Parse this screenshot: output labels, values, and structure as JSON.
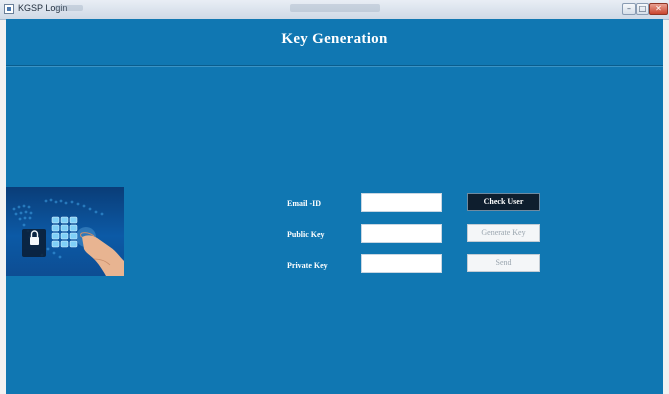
{
  "window": {
    "title": "KGSP Login",
    "minimize_label": "–",
    "maximize_label": "□",
    "close_label": "✕"
  },
  "header": {
    "title": "Key Generation"
  },
  "form": {
    "email_label": "Email -ID",
    "email_value": "",
    "public_key_label": "Public Key",
    "public_key_value": "",
    "private_key_label": "Private Key",
    "private_key_value": ""
  },
  "buttons": {
    "check_user": "Check User",
    "generate_key": "Generate Key",
    "send": "Send"
  },
  "colors": {
    "background": "#1077b2",
    "primary_button": "#0e1e2e",
    "disabled_button": "#f4f6f8"
  },
  "icons": {
    "app": "app-icon",
    "illustration": "security-keypad-illustration"
  }
}
